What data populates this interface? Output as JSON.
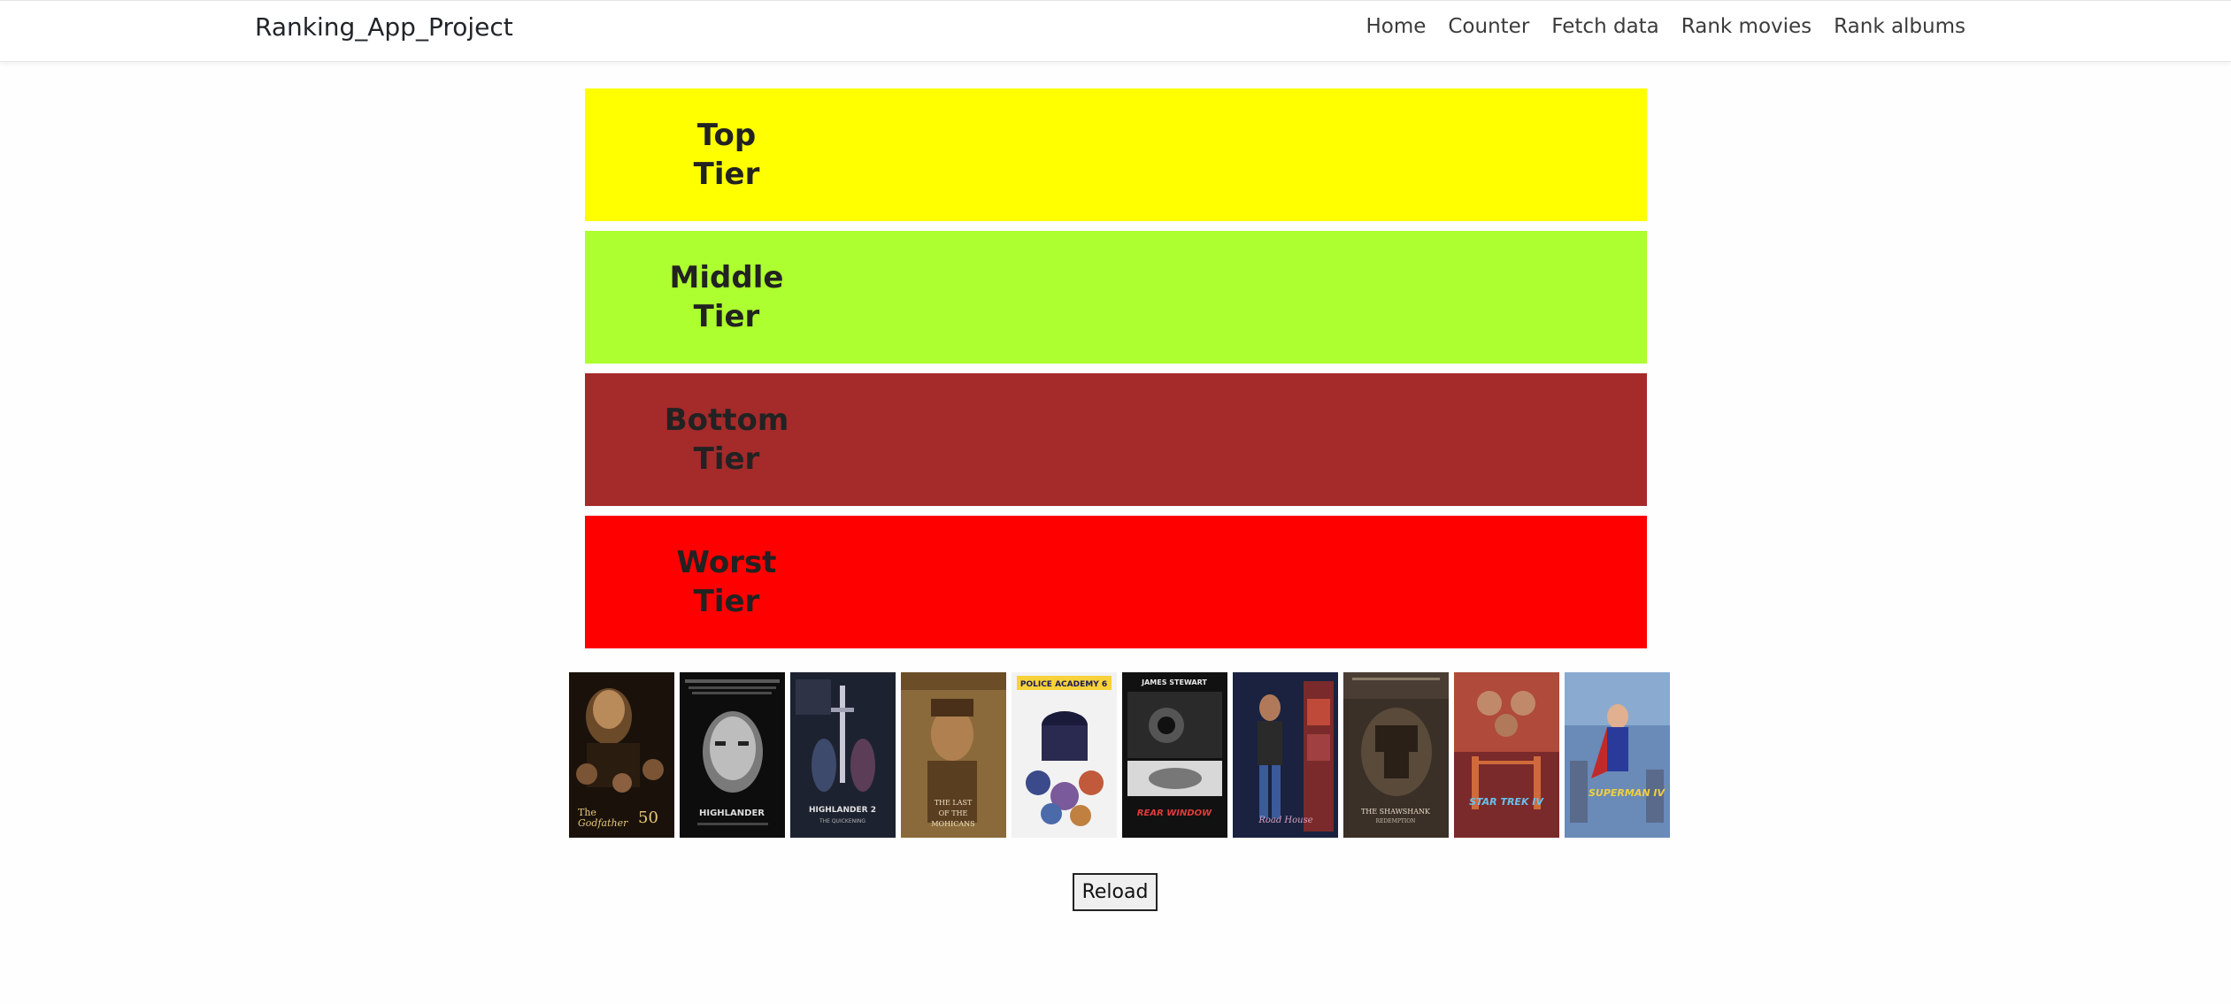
{
  "navbar": {
    "brand": "Ranking_App_Project",
    "links": [
      "Home",
      "Counter",
      "Fetch data",
      "Rank movies",
      "Rank albums"
    ]
  },
  "tiers": [
    {
      "line1": "Top",
      "line2": "Tier",
      "color": "#ffff00"
    },
    {
      "line1": "Middle",
      "line2": "Tier",
      "color": "#adff2f"
    },
    {
      "line1": "Bottom",
      "line2": "Tier",
      "color": "#a52a2a"
    },
    {
      "line1": "Worst",
      "line2": "Tier",
      "color": "#ff0000"
    }
  ],
  "movies": [
    {
      "name": "the-godfather-50-poster",
      "poster_text": "The Godfather 50"
    },
    {
      "name": "highlander-poster",
      "poster_text": "HIGHLANDER"
    },
    {
      "name": "highlander-2-poster",
      "poster_text": "HIGHLANDER 2 THE QUICKENING"
    },
    {
      "name": "last-of-the-mohicans-poster",
      "poster_text": "THE LAST OF THE MOHICANS"
    },
    {
      "name": "police-academy-6-poster",
      "poster_text": "POLICE ACADEMY 6"
    },
    {
      "name": "rear-window-poster",
      "poster_text": "JAMES STEWART REAR WINDOW"
    },
    {
      "name": "road-house-poster",
      "poster_text": "Road House"
    },
    {
      "name": "shawshank-redemption-poster",
      "poster_text": "THE SHAWSHANK REDEMPTION"
    },
    {
      "name": "star-trek-iv-poster",
      "poster_text": "STAR TREK IV"
    },
    {
      "name": "superman-iv-poster",
      "poster_text": "SUPERMAN IV"
    }
  ],
  "reload_label": "Reload"
}
